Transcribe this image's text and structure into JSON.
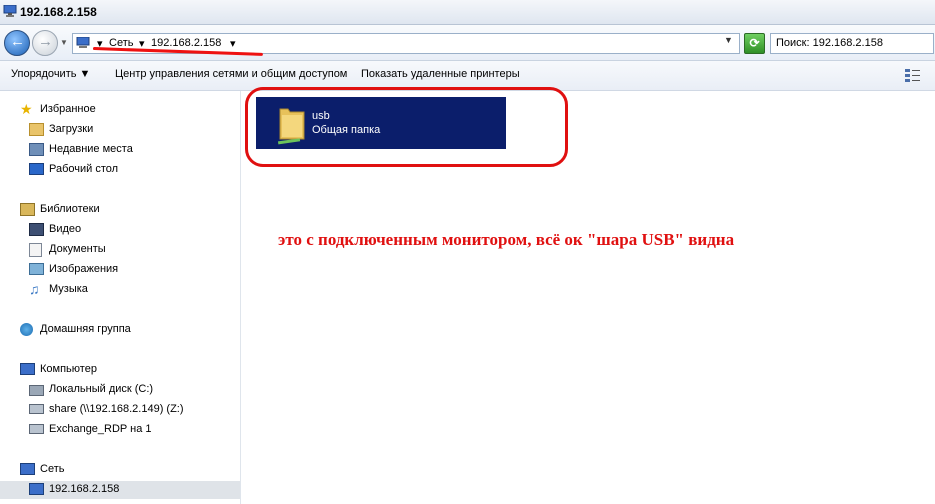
{
  "window": {
    "title": "192.168.2.158"
  },
  "address": {
    "crumbs": [
      "Сеть",
      "192.168.2.158"
    ],
    "search_value": "Поиск: 192.168.2.158"
  },
  "toolbar": {
    "organize": "Упорядочить",
    "network_center": "Центр управления сетями и общим доступом",
    "printers": "Показать удаленные принтеры"
  },
  "sidebar": {
    "favorites": "Избранное",
    "downloads": "Загрузки",
    "recent": "Недавние места",
    "desktop": "Рабочий стол",
    "libraries": "Библиотеки",
    "video": "Видео",
    "documents": "Документы",
    "images": "Изображения",
    "music": "Музыка",
    "homegroup": "Домашняя группа",
    "computer": "Компьютер",
    "local_disk": "Локальный диск (C:)",
    "share": "share (\\\\192.168.2.149) (Z:)",
    "exchange": "Exchange_RDP на 1",
    "network": "Сеть",
    "host": "192.168.2.158"
  },
  "items": [
    {
      "name": "usb",
      "subtitle": "Общая папка"
    }
  ],
  "annotation": "это с подключенным монитором, всё ок \"шара USB\" видна",
  "colors": {
    "selected_item": "#0b1e6b",
    "annotation": "#e01010"
  }
}
